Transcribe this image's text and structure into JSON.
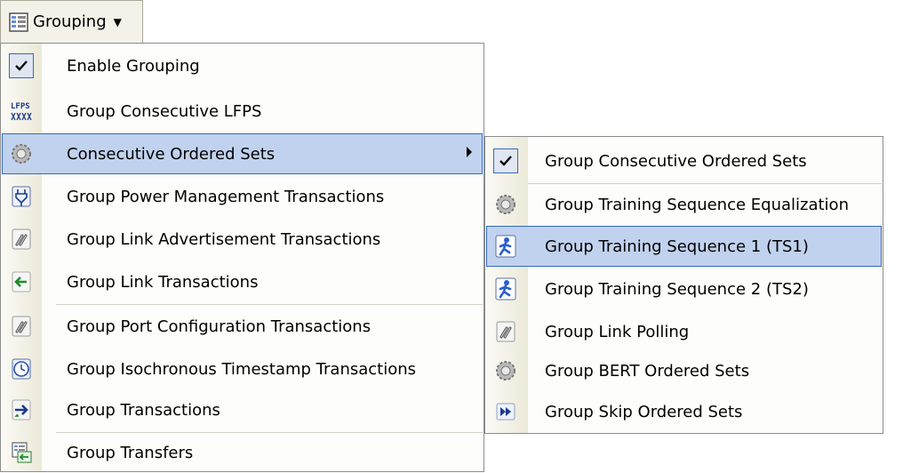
{
  "toolbar": {
    "label": "Grouping"
  },
  "menu": {
    "items": [
      {
        "label": "Enable Grouping",
        "icon": "check-icon"
      },
      {
        "label": "Group Consecutive LFPS",
        "icon": "lfps-icon"
      },
      {
        "label": "Consecutive Ordered Sets",
        "icon": "gear-icon"
      },
      {
        "label": "Group Power Management Transactions",
        "icon": "power-plug-icon"
      },
      {
        "label": "Group Link Advertisement Transactions",
        "icon": "chain-link-icon"
      },
      {
        "label": "Group Link Transactions",
        "icon": "arrow-left-icon"
      },
      {
        "label": "Group Port Configuration Transactions",
        "icon": "chain-link-icon"
      },
      {
        "label": "Group Isochronous Timestamp Transactions",
        "icon": "clock-icon"
      },
      {
        "label": "Group Transactions",
        "icon": "arrow-right-icon"
      },
      {
        "label": "Group Transfers",
        "icon": "transfers-icon"
      }
    ]
  },
  "submenu": {
    "items": [
      {
        "label": "Group Consecutive Ordered Sets",
        "icon": "check-icon"
      },
      {
        "label": "Group Training Sequence Equalization",
        "icon": "gear-icon"
      },
      {
        "label": "Group Training Sequence 1 (TS1)",
        "icon": "runner-icon"
      },
      {
        "label": "Group Training Sequence 2 (TS2)",
        "icon": "runner-icon"
      },
      {
        "label": "Group Link Polling",
        "icon": "chain-link-icon"
      },
      {
        "label": "Group BERT Ordered Sets",
        "icon": "gear-icon"
      },
      {
        "label": "Group Skip Ordered Sets",
        "icon": "fast-forward-icon"
      }
    ]
  },
  "colors": {
    "highlight": "#c1d2ee",
    "highlight_border": "#316ac5",
    "gutter": "#ece9d8"
  }
}
